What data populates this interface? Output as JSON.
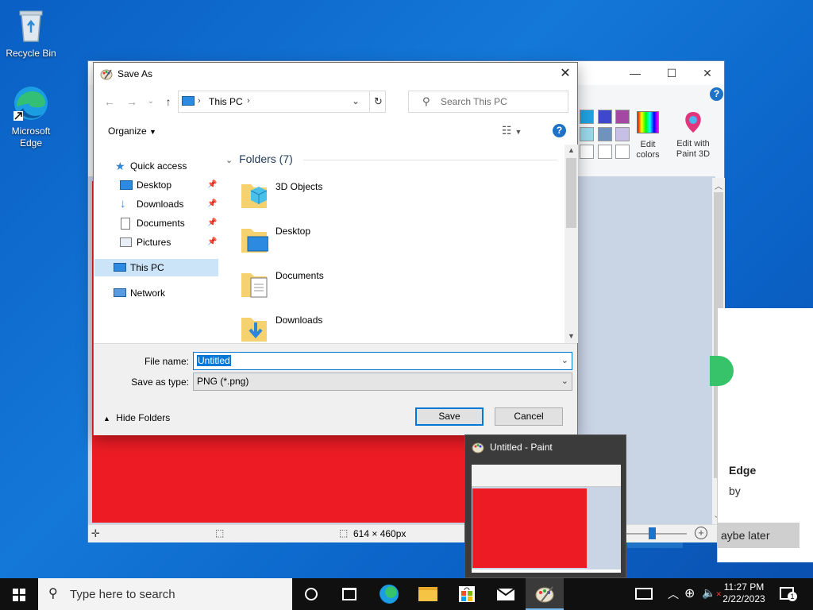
{
  "desktop": {
    "icons": [
      {
        "label": "Recycle Bin"
      },
      {
        "label": "Microsoft Edge"
      }
    ]
  },
  "paint": {
    "ribbon": {
      "edit_colors_label": "Edit colors",
      "edit_with_paint3d_label": "Edit with Paint 3D"
    },
    "status": {
      "canvas_size": "614 × 460px"
    },
    "canvas_color": "#ed1c24"
  },
  "edge_notification": {
    "title_partial": "Edge",
    "subtitle_partial": "by",
    "maybe_later_partial": "aybe later"
  },
  "dialog": {
    "title": "Save As",
    "breadcrumb_root": "This PC",
    "search_placeholder": "Search This PC",
    "organize_label": "Organize",
    "nav_pane": {
      "quick_access": "Quick access",
      "items": [
        "Desktop",
        "Downloads",
        "Documents",
        "Pictures"
      ],
      "this_pc": "This PC",
      "network": "Network"
    },
    "folders_header": "Folders (7)",
    "folders": [
      "3D Objects",
      "Desktop",
      "Documents",
      "Downloads"
    ],
    "file_name_label": "File name:",
    "file_name_value": "Untitled",
    "save_type_label": "Save as type:",
    "save_type_value": "PNG (*.png)",
    "hide_folders_label": "Hide Folders",
    "save_button": "Save",
    "cancel_button": "Cancel"
  },
  "preview": {
    "title": "Untitled - Paint"
  },
  "taskbar": {
    "search_placeholder": "Type here to search",
    "time": "11:27 PM",
    "date": "2/22/2023",
    "notification_count": "1"
  },
  "colors": {
    "accent": "#0078d7",
    "desktop_bg": "#0b63c8",
    "paint_red": "#ed1c24"
  }
}
